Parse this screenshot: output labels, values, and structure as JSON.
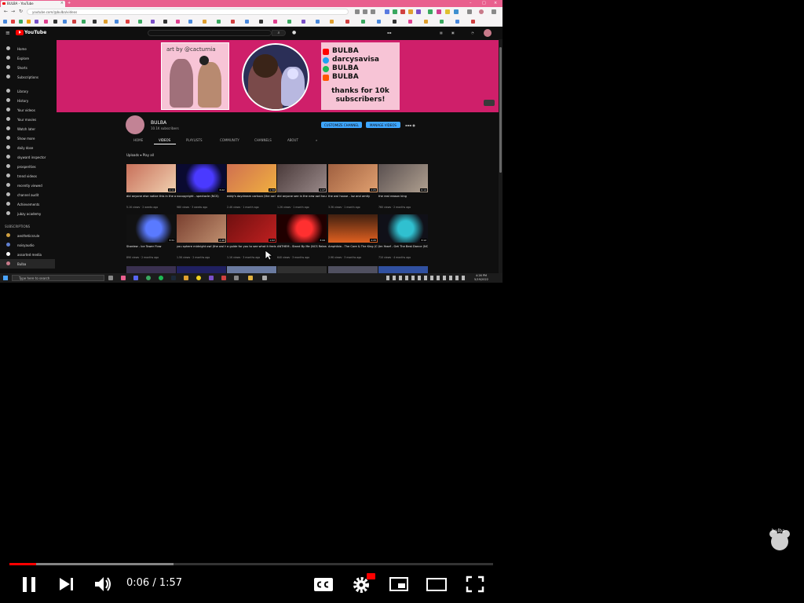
{
  "browser": {
    "tab_title": "BULBA - YouTube",
    "url": "youtube.com/@bulba/videos"
  },
  "youtube": {
    "logo_text": "YouTube"
  },
  "sidebar": {
    "items": [
      {
        "label": "Home"
      },
      {
        "label": "Explore"
      },
      {
        "label": "Shorts"
      },
      {
        "label": "Subscriptions"
      },
      {
        "label": "Library"
      },
      {
        "label": "History"
      },
      {
        "label": "Your videos"
      },
      {
        "label": "Your movies"
      },
      {
        "label": "Watch later"
      },
      {
        "label": "Show more"
      },
      {
        "label": "daily dose"
      },
      {
        "label": "skyward inspector"
      },
      {
        "label": "prosperities"
      },
      {
        "label": "trend videos"
      },
      {
        "label": "recently viewed"
      },
      {
        "label": "channel audit"
      },
      {
        "label": "Achievements"
      },
      {
        "label": "jubzy academy"
      }
    ],
    "subscriptions_heading": "SUBSCRIPTIONS",
    "subscriptions": [
      {
        "label": "aestheticsrule"
      },
      {
        "label": "noisyaudio"
      },
      {
        "label": "assorted media"
      },
      {
        "label": "Bulba"
      }
    ]
  },
  "banner": {
    "art_credit": "art by @cacturnia",
    "links": [
      "BULBA",
      "darcysavisa",
      "BULBA",
      "BULBA"
    ],
    "thanks": "thanks for 10k subscribers!"
  },
  "channel": {
    "name": "BULBA",
    "subs": "10.1K subscribers",
    "customize_label": "CUSTOMIZE CHANNEL",
    "manage_label": "MANAGE VIDEOS",
    "tabs": [
      "HOME",
      "VIDEOS",
      "PLAYLISTS",
      "COMMUNITY",
      "CHANNELS",
      "ABOUT"
    ],
    "sort_label": "Uploads ▾   Play all"
  },
  "videos": [
    {
      "title": "did anyone else notice this in the owl house?",
      "meta": "5.1K views · 2 weeks ago",
      "dur": "4:11"
    },
    {
      "title": "nocopyright - spectacle (NCS)",
      "meta": "980 views · 3 weeks ago",
      "dur": "3:22"
    },
    {
      "title": "eddy's daydream cartoon (the owl house meme)",
      "meta": "2.4K views · 1 month ago",
      "dur": "0:58"
    },
    {
      "title": "did anyone see in the new owl house episode?",
      "meta": "1.2K views · 1 month ago",
      "dur": "1:47"
    },
    {
      "title": "the owl house - luz and amity",
      "meta": "3.3K views · 1 month ago",
      "dur": "2:05"
    },
    {
      "title": "the real reason king",
      "meta": "760 views · 2 months ago",
      "dur": "6:14"
    },
    {
      "title": "Stardew - Ice Tower Flow",
      "meta": "890 views · 2 months ago",
      "dur": "3:31"
    },
    {
      "title": "you sphere midnight owl (the owl house cover)",
      "meta": "1.5K views · 2 months ago",
      "dur": "2:48"
    },
    {
      "title": "a guide for you to see what it feels like",
      "meta": "1.1K views · 3 months ago",
      "dur": "1:02"
    },
    {
      "title": "ANTHEM - Stand By Me (NCS Release)",
      "meta": "640 views · 3 months ago",
      "dur": "3:44"
    },
    {
      "title": "Amphibia - The Core & The King (Cut)",
      "meta": "2.9K views · 3 months ago",
      "dur": "4:20"
    },
    {
      "title": "Jim Yosef - Get The Best Dance (NCS)",
      "meta": "710 views · 4 months ago",
      "dur": "3:12"
    }
  ],
  "taskbar": {
    "search_placeholder": "Type here to search",
    "time": "4:26 PM",
    "date": "5/19/2022"
  },
  "player": {
    "time": "0:06 / 1:57",
    "progress_played": 0.055,
    "progress_buffered": 0.34,
    "accent": "#ff0000"
  },
  "watermark_text": "bulba"
}
